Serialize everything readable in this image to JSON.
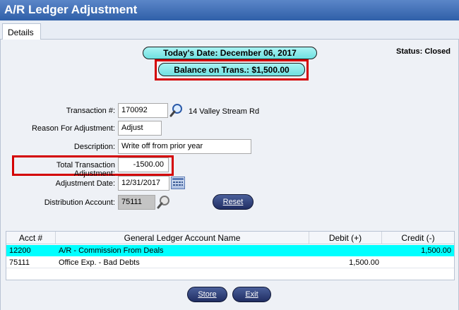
{
  "window": {
    "title": "A/R Ledger Adjustment"
  },
  "tabs": [
    {
      "label": "Details"
    }
  ],
  "header": {
    "todays_date": "Today's Date: December 06, 2017",
    "balance": "Balance on Trans.: $1,500.00",
    "status": "Status: Closed"
  },
  "form": {
    "transaction_label": "Transaction #:",
    "transaction_value": "170092",
    "address": "14 Valley Stream Rd",
    "reason_label": "Reason For Adjustment:",
    "reason_value": "Adjust",
    "description_label": "Description:",
    "description_value": "Write off from prior year",
    "total_label": "Total Transaction Adjustment:",
    "total_value": "-1500.00",
    "date_label": "Adjustment Date:",
    "date_value": "12/31/2017",
    "dist_label": "Distribution Account:",
    "dist_value": "75111",
    "reset_label": "Reset"
  },
  "grid": {
    "columns": [
      "Acct #",
      "General Ledger Account Name",
      "Debit (+)",
      "Credit (-)"
    ],
    "rows": [
      {
        "acct": "12200",
        "name": "A/R - Commission From Deals",
        "debit": "",
        "credit": "1,500.00",
        "highlight": true
      },
      {
        "acct": "75111",
        "name": "Office Exp. - Bad Debts",
        "debit": "1,500.00",
        "credit": "",
        "highlight": false
      }
    ]
  },
  "buttons": {
    "store": "Store",
    "exit": "Exit"
  },
  "colors": {
    "accent": "#2f5fa8",
    "highlight": "#00ffff",
    "alert": "#d40000"
  }
}
